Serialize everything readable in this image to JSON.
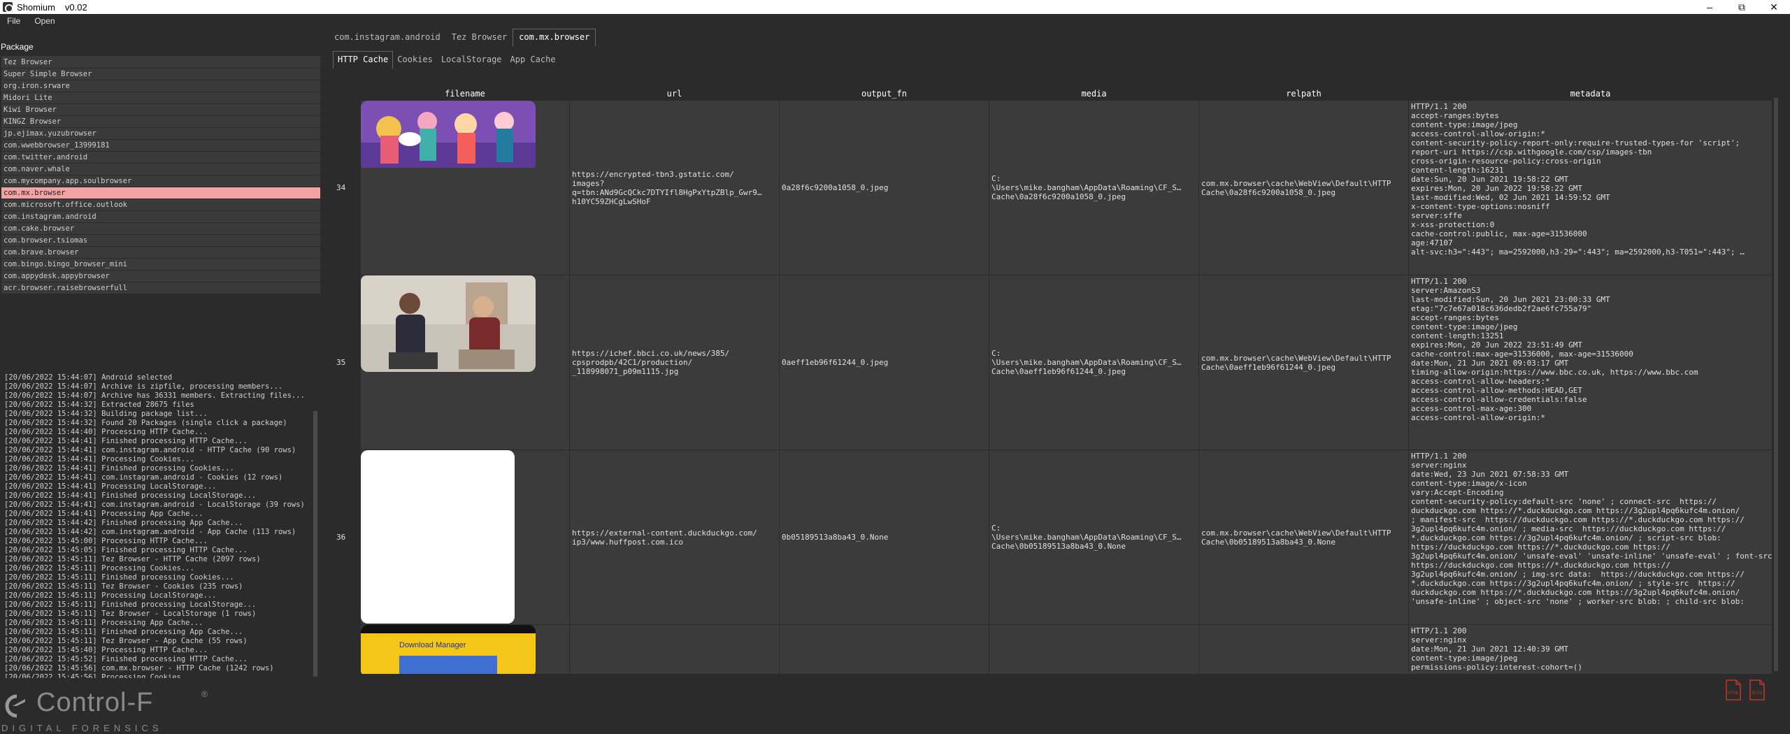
{
  "window": {
    "app_name": "Shomium",
    "version": "v0.02"
  },
  "menu": [
    "File",
    "Open"
  ],
  "packages": {
    "header": "Package",
    "items": [
      "Tez Browser",
      "Super Simple Browser",
      "org.iron.srware",
      "Midori Lite",
      "Kiwi Browser",
      "KINGZ Browser",
      "jp.ejimax.yuzubrowser",
      "com.wwebbrowser_13999181",
      "com.twitter.android",
      "com.naver.whale",
      "com.mycompany.app.soulbrowser",
      "com.mx.browser",
      "com.microsoft.office.outlook",
      "com.instagram.android",
      "com.cake.browser",
      "com.browser.tsiomas",
      "com.brave.browser",
      "com.bingo.bingo_browser_mini",
      "com.appydesk.appybrowser",
      "acr.browser.raisebrowserfull"
    ],
    "selected_index": 11
  },
  "log": [
    "[20/06/2022 15:44:07] Android selected",
    "[20/06/2022 15:44:07] Archive is zipfile, processing members...",
    "[20/06/2022 15:44:07] Archive has 36331 members. Extracting files...",
    "[20/06/2022 15:44:32] Extracted 28675 files",
    "[20/06/2022 15:44:32] Building package list...",
    "[20/06/2022 15:44:32] Found 20 Packages (single click a package)",
    "[20/06/2022 15:44:40] Processing HTTP Cache...",
    "[20/06/2022 15:44:41] Finished processing HTTP Cache...",
    "[20/06/2022 15:44:41] com.instagram.android - HTTP Cache (90 rows)",
    "[20/06/2022 15:44:41] Processing Cookies...",
    "[20/06/2022 15:44:41] Finished processing Cookies...",
    "[20/06/2022 15:44:41] com.instagram.android - Cookies (12 rows)",
    "[20/06/2022 15:44:41] Processing LocalStorage...",
    "[20/06/2022 15:44:41] Finished processing LocalStorage...",
    "[20/06/2022 15:44:41] com.instagram.android - LocalStorage (39 rows)",
    "[20/06/2022 15:44:41] Processing App Cache...",
    "[20/06/2022 15:44:42] Finished processing App Cache...",
    "[20/06/2022 15:44:42] com.instagram.android - App Cache (113 rows)",
    "[20/06/2022 15:45:00] Processing HTTP Cache...",
    "[20/06/2022 15:45:05] Finished processing HTTP Cache...",
    "[20/06/2022 15:45:11] Tez Browser - HTTP Cache (2097 rows)",
    "[20/06/2022 15:45:11] Processing Cookies...",
    "[20/06/2022 15:45:11] Finished processing Cookies...",
    "[20/06/2022 15:45:11] Tez Browser - Cookies (235 rows)",
    "[20/06/2022 15:45:11] Processing LocalStorage...",
    "[20/06/2022 15:45:11] Finished processing LocalStorage...",
    "[20/06/2022 15:45:11] Tez Browser - LocalStorage (1 rows)",
    "[20/06/2022 15:45:11] Processing App Cache...",
    "[20/06/2022 15:45:11] Finished processing App Cache...",
    "[20/06/2022 15:45:11] Tez Browser - App Cache (55 rows)",
    "[20/06/2022 15:45:40] Processing HTTP Cache...",
    "[20/06/2022 15:45:52] Finished processing HTTP Cache...",
    "[20/06/2022 15:45:56] com.mx.browser - HTTP Cache (1242 rows)",
    "[20/06/2022 15:45:56] Processing Cookies..."
  ],
  "logo": {
    "name": "Control-F",
    "tagline": "DIGITAL FORENSICS",
    "mark": "®"
  },
  "pkg_tabs": [
    "com.instagram.android",
    "Tez Browser",
    "com.mx.browser"
  ],
  "pkg_tab_active": 2,
  "sub_tabs": [
    "HTTP Cache",
    "Cookies",
    "LocalStorage",
    "App Cache"
  ],
  "sub_tab_active": 0,
  "table": {
    "columns": [
      "filename",
      "url",
      "output_fn",
      "media",
      "relpath",
      "metadata"
    ],
    "rows": [
      {
        "num": "34",
        "thumb": "purple-illustration",
        "url": "https://encrypted-tbn3.gstatic.com/\nimages?\nq=tbn:ANd9GcQCkc7DTYIfl8HgPxYtpZBlp_Gwr9…\nh10YC59ZHCgLwSHoF",
        "output_fn": "0a28f6c9200a1058_0.jpeg",
        "media": "C:\n\\Users\\mike.bangham\\AppData\\Roaming\\CF_S…\nCache\\0a28f6c9200a1058_0.jpeg",
        "relpath": "com.mx.browser\\cache\\WebView\\Default\\HTTP\nCache\\0a28f6c9200a1058_0.jpeg",
        "metadata": "HTTP/1.1 200\naccept-ranges:bytes\ncontent-type:image/jpeg\naccess-control-allow-origin:*\ncontent-security-policy-report-only:require-trusted-types-for 'script';\nreport-uri https://csp.withgoogle.com/csp/images-tbn\ncross-origin-resource-policy:cross-origin\ncontent-length:16231\ndate:Sun, 20 Jun 2021 19:58:22 GMT\nexpires:Mon, 20 Jun 2022 19:58:22 GMT\nlast-modified:Wed, 02 Jun 2021 14:59:52 GMT\nx-content-type-options:nosniff\nserver:sffe\nx-xss-protection:0\ncache-control:public, max-age=31536000\nage:47107\nalt-svc:h3=\":443\"; ma=2592000,h3-29=\":443\"; ma=2592000,h3-T051=\":443\"; …"
      },
      {
        "num": "35",
        "thumb": "interview-photo",
        "url": "https://ichef.bbci.co.uk/news/385/\ncpsprodpb/42C1/production/\n_118998071_p09m1115.jpg",
        "output_fn": "0aeff1eb96f61244_0.jpeg",
        "media": "C:\n\\Users\\mike.bangham\\AppData\\Roaming\\CF_S…\nCache\\0aeff1eb96f61244_0.jpeg",
        "relpath": "com.mx.browser\\cache\\WebView\\Default\\HTTP\nCache\\0aeff1eb96f61244_0.jpeg",
        "metadata": "HTTP/1.1 200\nserver:AmazonS3\nlast-modified:Sun, 20 Jun 2021 23:00:33 GMT\netag:\"7c7e67a018c636dedb2f2ae6fc755a79\"\naccept-ranges:bytes\ncontent-type:image/jpeg\ncontent-length:13251\nexpires:Mon, 20 Jun 2022 23:51:49 GMT\ncache-control:max-age=31536000, max-age=31536000\ndate:Mon, 21 Jun 2021 09:03:17 GMT\ntiming-allow-origin:https://www.bbc.co.uk, https://www.bbc.com\naccess-control-allow-headers:*\naccess-control-allow-methods:HEAD,GET\naccess-control-allow-credentials:false\naccess-control-max-age:300\naccess-control-allow-origin:*"
      },
      {
        "num": "36",
        "thumb": "white-icon",
        "url": "https://external-content.duckduckgo.com/\nip3/www.huffpost.com.ico",
        "output_fn": "0b05189513a8ba43_0.None",
        "media": "C:\n\\Users\\mike.bangham\\AppData\\Roaming\\CF_S…\nCache\\0b05189513a8ba43_0.None",
        "relpath": "com.mx.browser\\cache\\WebView\\Default\\HTTP\nCache\\0b05189513a8ba43_0.None",
        "metadata": "HTTP/1.1 200\nserver:nginx\ndate:Wed, 23 Jun 2021 07:58:33 GMT\ncontent-type:image/x-icon\nvary:Accept-Encoding\ncontent-security-policy:default-src 'none' ; connect-src  https://\nduckduckgo.com https://*.duckduckgo.com https://3g2upl4pq6kufc4m.onion/\n; manifest-src  https://duckduckgo.com https://*.duckduckgo.com https://\n3g2upl4pq6kufc4m.onion/ ; media-src  https://duckduckgo.com https://\n*.duckduckgo.com https://3g2upl4pq6kufc4m.onion/ ; script-src blob:\nhttps://duckduckgo.com https://*.duckduckgo.com https://\n3g2upl4pq6kufc4m.onion/ 'unsafe-eval' 'unsafe-inline' 'unsafe-eval' ; font-src data:\nhttps://duckduckgo.com https://*.duckduckgo.com https://\n3g2upl4pq6kufc4m.onion/ ; img-src data:  https://duckduckgo.com https://\n*.duckduckgo.com https://3g2upl4pq6kufc4m.onion/ ; style-src  https://\nduckduckgo.com https://*.duckduckgo.com https://3g2upl4pq6kufc4m.onion/\n'unsafe-inline' ; object-src 'none' ; worker-src blob: ; child-src blob:"
      },
      {
        "num": "",
        "thumb": "download-manager",
        "thumb_text": "Download Manager",
        "url": "",
        "output_fn": "",
        "media": "",
        "relpath": "",
        "metadata": "HTTP/1.1 200\nserver:nginx\ndate:Mon, 21 Jun 2021 12:40:39 GMT\ncontent-type:image/jpeg\npermissions-policy:interest-cohort=()"
      }
    ]
  },
  "export_icons": [
    "html-export-icon",
    "xlsx-export-icon"
  ],
  "export_labels": [
    "HTML",
    "XLSX"
  ]
}
